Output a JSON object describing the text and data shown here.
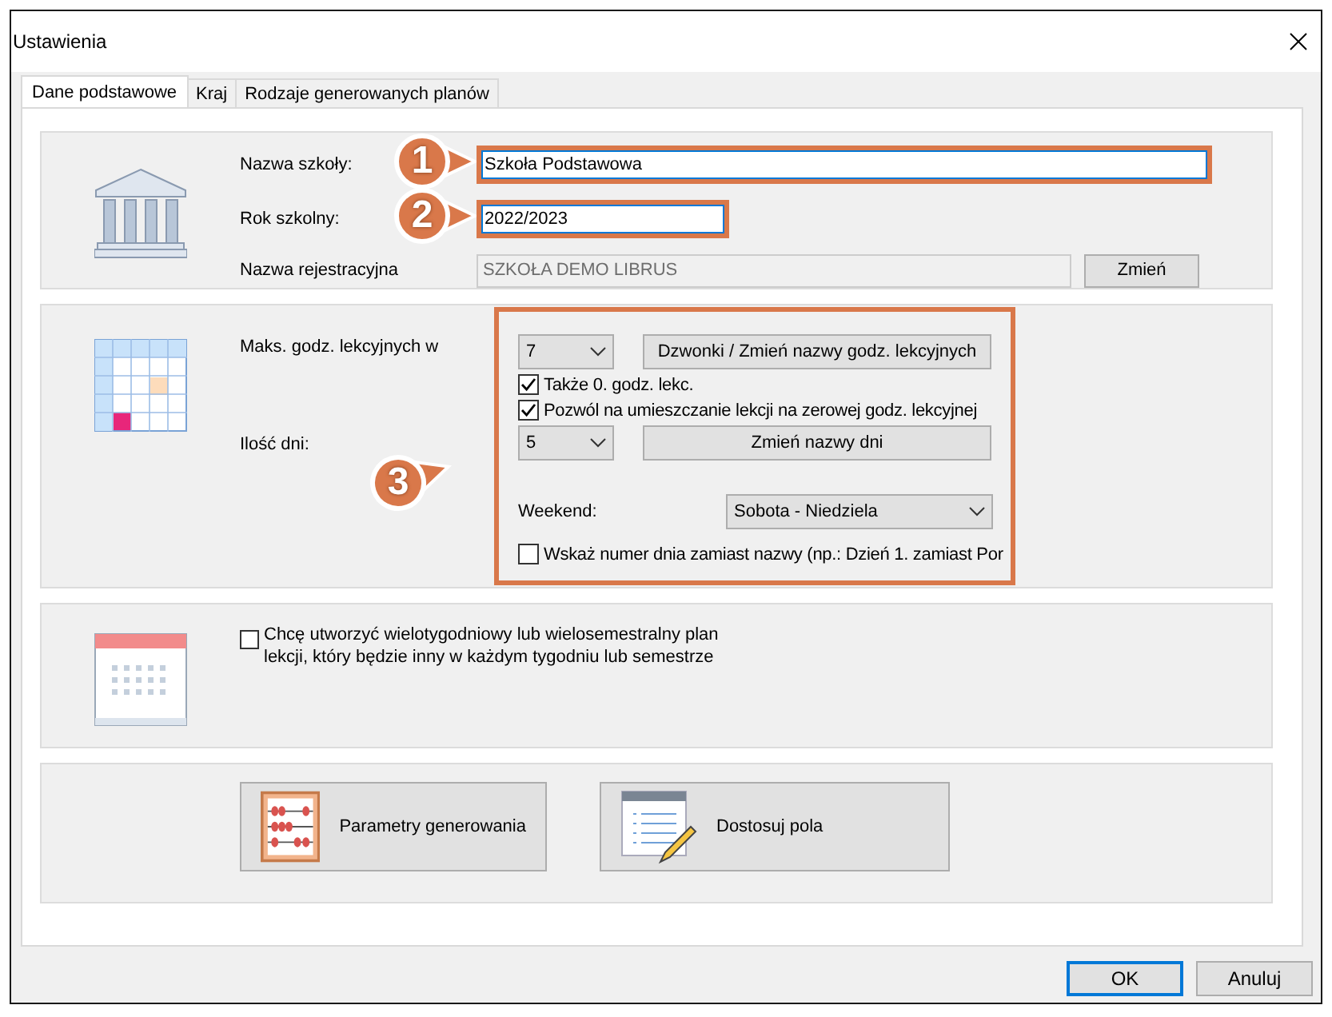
{
  "window": {
    "title": "Ustawienia"
  },
  "tabs": [
    {
      "label": "Dane podstawowe",
      "selected": true
    },
    {
      "label": "Kraj",
      "selected": false
    },
    {
      "label": "Rodzaje generowanych planów",
      "selected": false
    }
  ],
  "school": {
    "name_label": "Nazwa szkoły:",
    "name_value": "Szkoła Podstawowa",
    "name_callout": "1",
    "year_label": "Rok szkolny:",
    "year_value": "2022/2023",
    "year_callout": "2",
    "registration_label": "Nazwa rejestracyjna",
    "registration_value": "SZKOŁA DEMO LIBRUS",
    "registration_disabled": true,
    "change_button": "Zmień"
  },
  "hours": {
    "callout": "3",
    "max_label": "Maks. godz. lekcyjnych w",
    "max_value": "7",
    "bells_button": "Dzwonki / Zmień nazwy godz. lekcyjnych",
    "options": [
      {
        "label": "Także 0. godz. lekc.",
        "checked": true
      },
      {
        "label": "Pozwól na umieszczanie lekcji na zerowej godz. lekcyjnej",
        "checked": true
      }
    ],
    "days_label": "Ilość dni:",
    "days_value": "5",
    "rename_days_button": "Zmień nazwy dni",
    "weekend_label": "Weekend:",
    "weekend_value": "Sobota - Niedziela",
    "day_number": {
      "label": "Wskaż numer dnia zamiast nazwy (np.: Dzień 1. zamiast Por",
      "checked": false
    }
  },
  "multiweek": {
    "label": "Chcę utworzyć wielotygodniowy lub wielosemestralny plan lekcji, który będzie inny w każdym tygodniu lub semestrze",
    "checked": false
  },
  "tools": [
    {
      "kind": "abacus",
      "label": "Parametry generowania"
    },
    {
      "kind": "form",
      "label": "Dostosuj pola"
    }
  ],
  "buttons": [
    {
      "label": "OK",
      "default": true
    },
    {
      "label": "Anuluj",
      "default": false
    }
  ]
}
